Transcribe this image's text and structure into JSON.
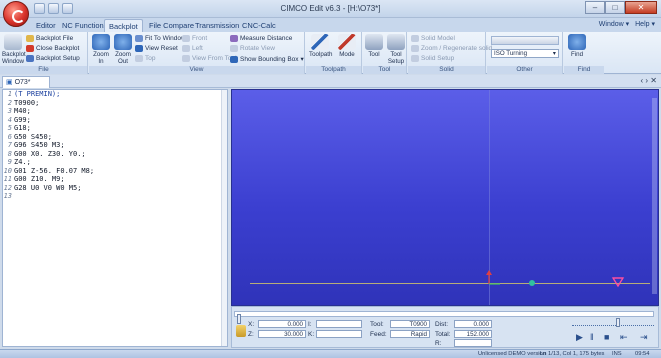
{
  "titlebar": {
    "title": "CIMCO Edit v6.3 - [H:\\O73*]",
    "minimize": "–",
    "maximize": "□",
    "close": "✕"
  },
  "tabs": [
    {
      "label": "Editor"
    },
    {
      "label": "NC Functions"
    },
    {
      "label": "Backplot"
    },
    {
      "label": "File Compare"
    },
    {
      "label": "Transmission"
    },
    {
      "label": "CNC-Calc"
    }
  ],
  "active_tab": "Backplot",
  "tabs_right": "Window",
  "help": "Help",
  "ribbon": {
    "file_group": {
      "label": "File",
      "backplot_window": "Backplot Window",
      "backplot_file": "Backplot File",
      "close_backplot": "Close Backplot",
      "backplot_setup": "Backplot Setup"
    },
    "view_group": {
      "label": "View",
      "zoom_in": "Zoom In",
      "zoom_out": "Zoom Out",
      "fit_to_window": "Fit To Window",
      "view_reset": "View Reset",
      "top": "Top",
      "front": "Front",
      "left": "Left",
      "view_from_tool": "View From Tool",
      "measure_distance": "Measure Distance",
      "rotate_view": "Rotate View",
      "show_bounding_box": "Show Bounding Box"
    },
    "toolpath_group": {
      "label": "Toolpath",
      "toolpath": "Toolpath",
      "mode": "Mode"
    },
    "tool_group": {
      "label": "Tool",
      "tool": "Tool",
      "tool_setup": "Tool Setup"
    },
    "solid_group": {
      "label": "Solid",
      "solid_model": "Solid Model",
      "zoom_regenerate": "Zoom / Regenerate solid",
      "solid_setup": "Solid Setup"
    },
    "other_group": {
      "label": "Other",
      "machine_combo": "ISO Turning"
    },
    "find_group": {
      "label": "Find",
      "find": "Find"
    }
  },
  "document": {
    "tab_label": "O73*",
    "close_glyph": "‹ › ✕"
  },
  "editor": {
    "lines": [
      {
        "n": "1",
        "text": "(T PREMIN);",
        "style": "comment"
      },
      {
        "n": "2",
        "text": "T0900;",
        "style": ""
      },
      {
        "n": "3",
        "text": "M40;",
        "style": ""
      },
      {
        "n": "4",
        "text": "G99;",
        "style": ""
      },
      {
        "n": "5",
        "text": "G18;",
        "style": ""
      },
      {
        "n": "6",
        "text": "G50 S450;",
        "style": ""
      },
      {
        "n": "7",
        "text": "G96 S450 M3;",
        "style": ""
      },
      {
        "n": "8",
        "text": "G00 X0. Z30. Y0.;",
        "style": ""
      },
      {
        "n": "9",
        "text": "Z4.;",
        "style": ""
      },
      {
        "n": "10",
        "text": "G01 Z-56. F0.07 M8;",
        "style": ""
      },
      {
        "n": "11",
        "text": "G00 Z10. M9;",
        "style": ""
      },
      {
        "n": "12",
        "text": "G28 U0 V0 W0 M5;",
        "style": ""
      },
      {
        "n": "13",
        "text": "",
        "style": ""
      }
    ]
  },
  "controls": {
    "x_label": "X:",
    "z_label": "Z:",
    "x_value": "0.000",
    "z_value": "30.000",
    "i_label": "I:",
    "k_label": "K:",
    "tool_label": "Tool:",
    "tool_value": "T0900",
    "feed_label": "Feed:",
    "feed_value": "Rapid",
    "dist_label": "Dist:",
    "dist_value": "0.000",
    "total_label": "Total:",
    "total_value": "152.000",
    "r_label": "R:"
  },
  "statusbar": {
    "left": "Unlicensed DEMO version",
    "position": "Ln 1/13, Col 1, 175 bytes",
    "mode": "INS",
    "time": "09:54"
  },
  "colors": {
    "viewport_top": "#5b5ee8",
    "viewport_bottom": "#2f33b9",
    "axis": "#b7ad78",
    "orb": "#d9322a",
    "comment_code": "#1a3f9e"
  }
}
